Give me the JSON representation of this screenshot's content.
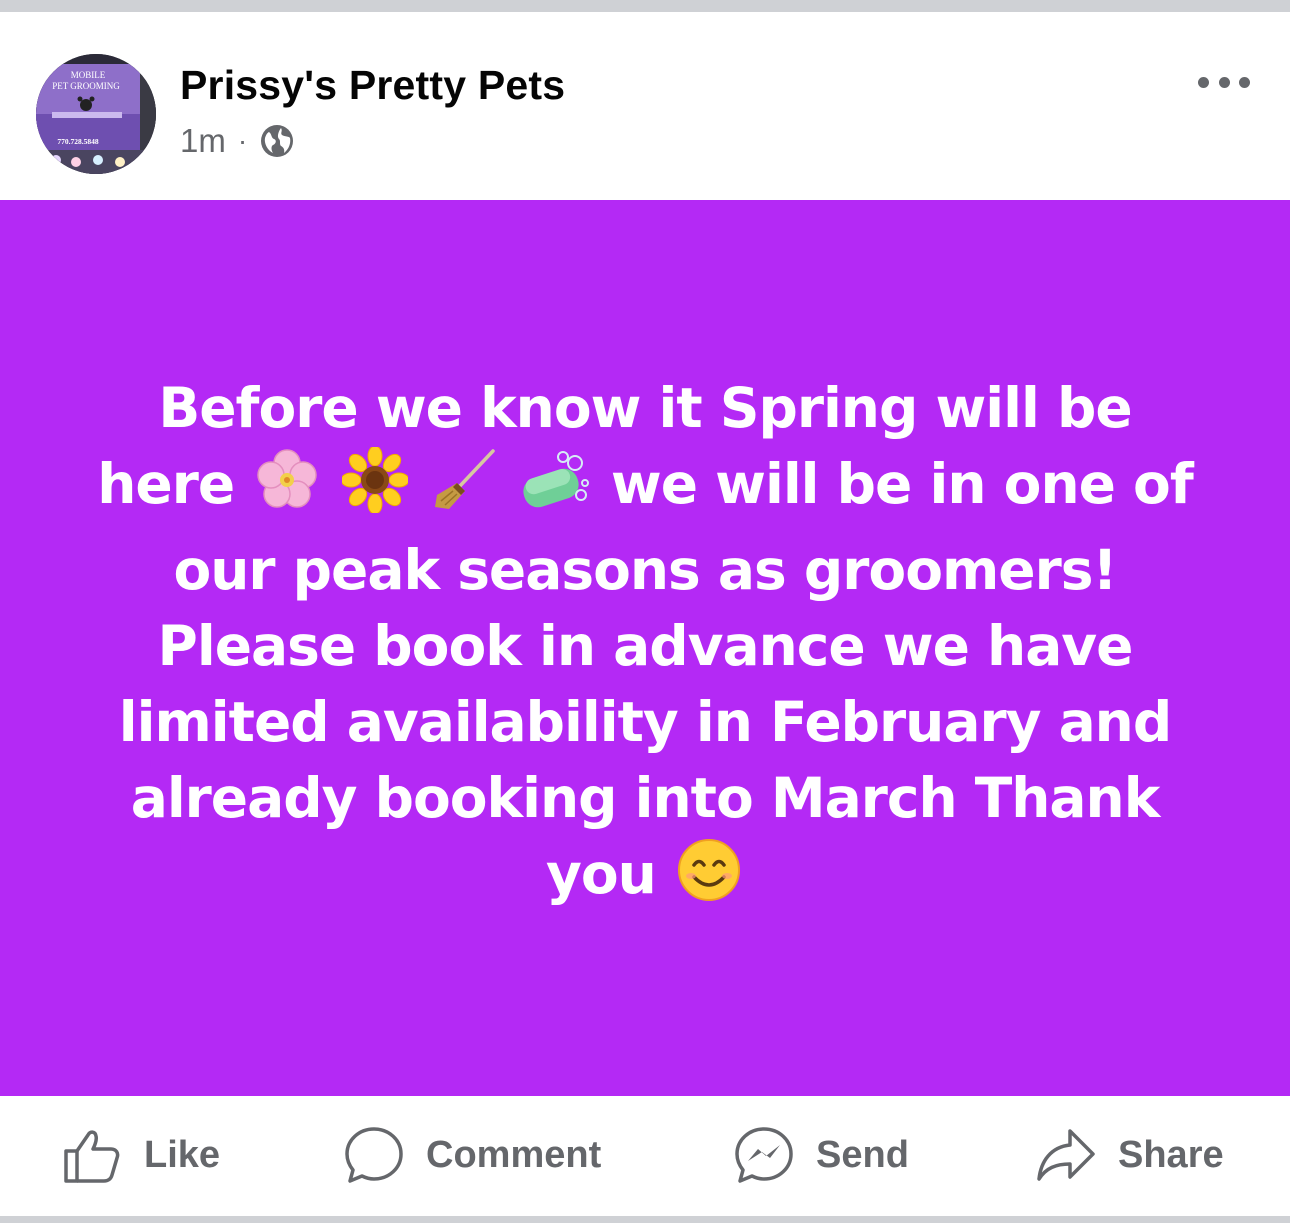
{
  "post": {
    "author": "Prissy's Pretty Pets",
    "timestamp": "1m",
    "separator": "·",
    "audience_icon": "globe-icon",
    "background_color": "#b429f5",
    "text": {
      "line1": "Before we know it Spring will be",
      "line2_before": "here",
      "line2_after": "we will be in one of",
      "line3": "our peak seasons as groomers!",
      "line4": "Please book in advance we have",
      "line5": "limited availability in February and",
      "line6": "already booking into March Thank",
      "line7": "you"
    },
    "emojis": [
      "cherry-blossom-emoji",
      "sunflower-emoji",
      "broom-emoji",
      "soap-emoji",
      "smiling-face-emoji"
    ]
  },
  "avatar": {
    "line1": "MOBILE",
    "line2": "PET GROOMING",
    "phone": "770.728.5848"
  },
  "actions": {
    "like": "Like",
    "comment": "Comment",
    "send": "Send",
    "share": "Share"
  },
  "colors": {
    "text_secondary": "#65676b",
    "divider": "#cfd1d5"
  }
}
